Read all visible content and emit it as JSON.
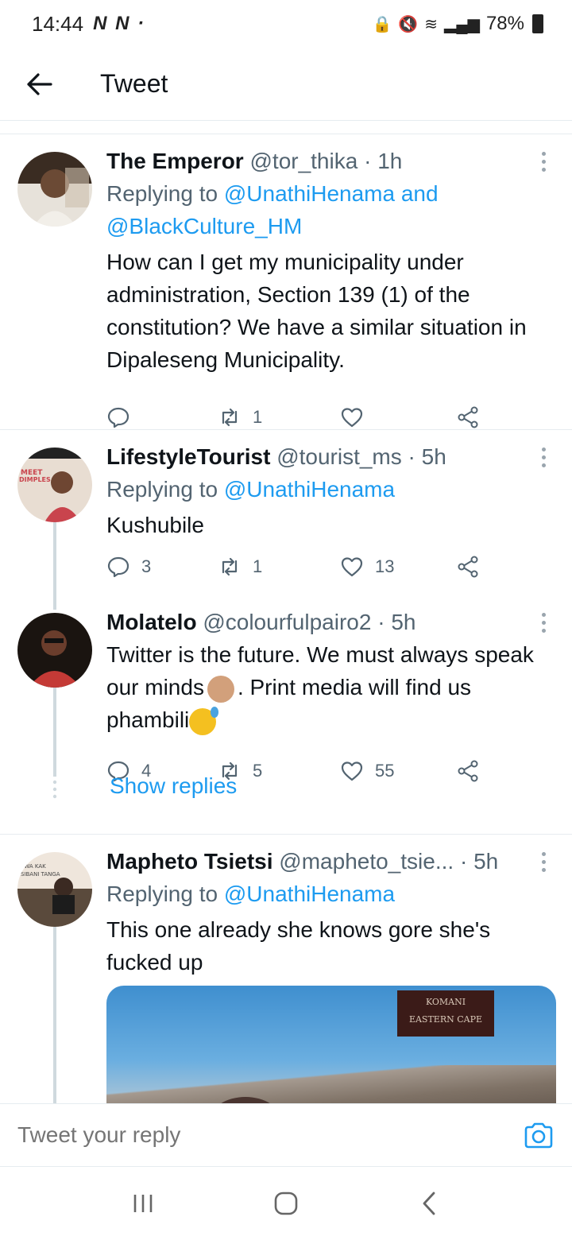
{
  "status_bar": {
    "time": "14:44",
    "app_icons": "N N ·",
    "battery": "78%"
  },
  "header": {
    "title": "Tweet",
    "back_icon": "arrow-left-icon"
  },
  "tweets": [
    {
      "name": "The Emperor",
      "handle": "@tor_thika",
      "dot": "·",
      "age": "1h",
      "replying_prefix": "Replying to",
      "mentions": "@UnathiHenama and @BlackCulture_HM",
      "text": "How can I get my municipality under administration, Section 139 (1) of the constitution? We have a similar situation in Dipaleseng Municipality.",
      "replies": "",
      "retweets": "1",
      "likes": ""
    },
    {
      "name": "LifestyleTourist",
      "handle": "@tourist_ms",
      "dot": "·",
      "age": "5h",
      "replying_prefix": "Replying to",
      "mentions": "@UnathiHenama",
      "text": "Kushubile",
      "replies": "3",
      "retweets": "1",
      "likes": "13"
    },
    {
      "name": "Molatelo",
      "handle": "@colourfulpairo2",
      "dot": "·",
      "age": "5h",
      "text_part1": "Twitter is the future. We must always speak our minds",
      "text_part2": ". Print media will find us phambili",
      "replies": "4",
      "retweets": "5",
      "likes": "55"
    },
    {
      "name": "Mapheto Tsietsi",
      "handle": "@mapheto_tsie...",
      "dot": "·",
      "age": "5h",
      "replying_prefix": "Replying to",
      "mentions": "@UnathiHenama",
      "text": "This one already she knows gore she's fucked up",
      "media_sign_line1": "KOMANI",
      "media_sign_line2": "EASTERN CAPE"
    }
  ],
  "show_replies": "Show replies",
  "reply_bar": {
    "placeholder": "Tweet your reply"
  },
  "colors": {
    "accent": "#1d9bf0",
    "secondary_text": "#536471",
    "divider": "#e6ecf0"
  }
}
